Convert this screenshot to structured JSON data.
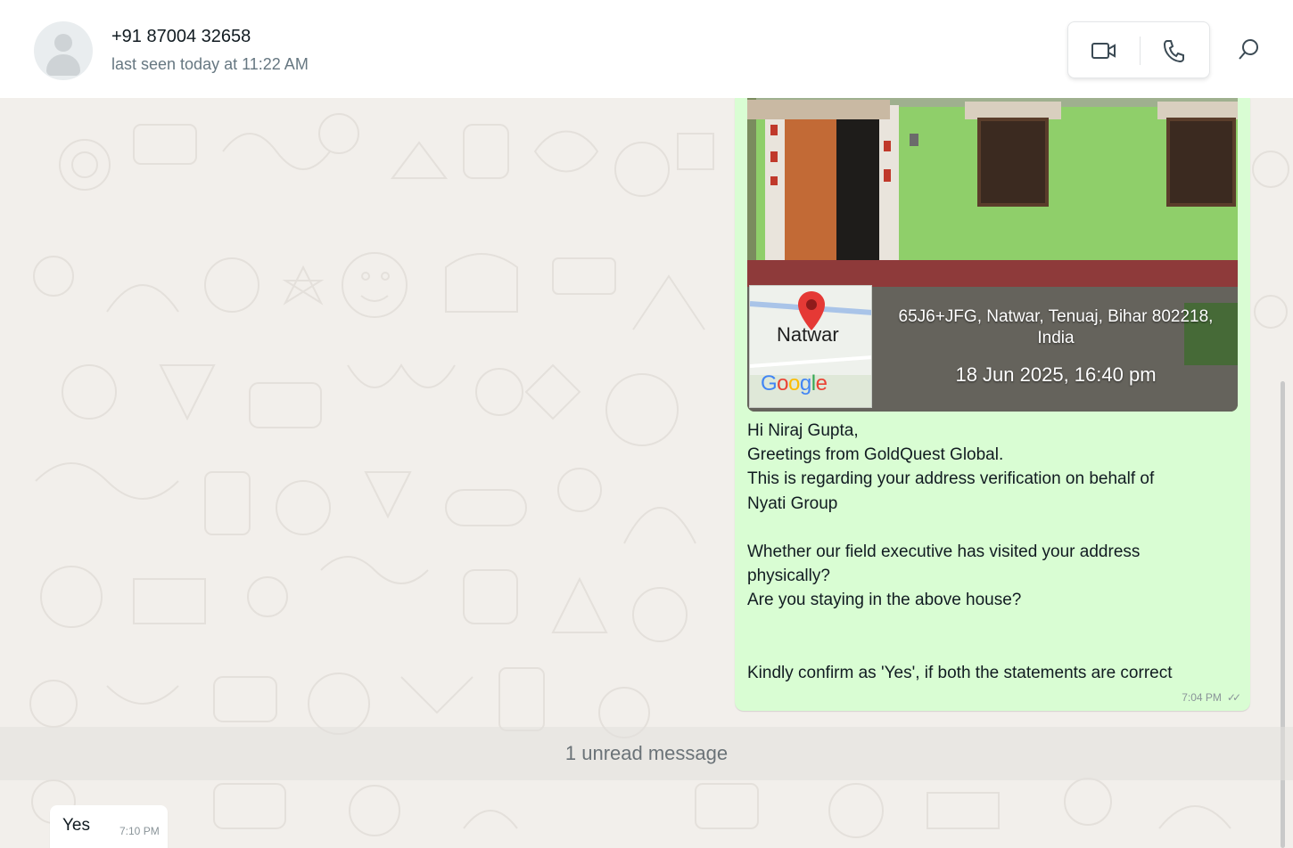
{
  "header": {
    "contact_name": "+91 87004 32658",
    "last_seen": "last seen today at 11:22 AM",
    "icons": [
      "avatar-placeholder",
      "video-call-icon",
      "voice-call-icon",
      "search-icon"
    ]
  },
  "outgoing_message": {
    "photo": {
      "map_place": "Natwar",
      "map_brand": "Google",
      "address": "65J6+JFG, Natwar, Tenuaj, Bihar 802218, India",
      "datetime": "18 Jun 2025, 16:40 pm"
    },
    "lines": [
      "Hi Niraj Gupta,",
      "Greetings from GoldQuest Global.",
      "This is regarding your address verification on behalf of",
      "Nyati Group",
      "",
      "Whether our field executive has visited your address",
      "physically?",
      "Are you staying in the above house?",
      "",
      "",
      "Kindly confirm as 'Yes', if both the statements are correct"
    ],
    "time": "7:04 PM",
    "status_icon": "double-check-icon"
  },
  "unread_divider": "1 unread message",
  "incoming_message": {
    "text": "Yes",
    "time": "7:10 PM"
  },
  "colors": {
    "outgoing_bubble": "#d9fdd3",
    "incoming_bubble": "#ffffff",
    "chat_background": "#f2efeb",
    "wall_green": "#8fcf6a",
    "map_pin": "#e53935"
  }
}
